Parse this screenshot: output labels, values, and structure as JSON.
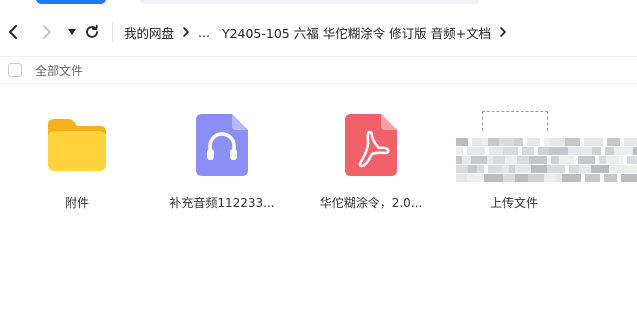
{
  "nav": {
    "back_icon": "chevron-left-icon",
    "forward_icon": "chevron-right-icon",
    "history_icon": "caret-down-icon",
    "refresh_icon": "refresh-icon"
  },
  "breadcrumb": {
    "root": "我的网盘",
    "ellipsis": "...",
    "current": "Y2405-105 六福 华佗糊涂令 修订版 音频+文档"
  },
  "toolbar": {
    "select_all_label": "全部文件"
  },
  "files": [
    {
      "name": "附件",
      "type": "folder",
      "icon": "folder-icon",
      "color": "#fbc02d"
    },
    {
      "name": "补充音频112233...",
      "type": "audio",
      "icon": "headphones-icon",
      "color": "#8b8ff5"
    },
    {
      "name": "华佗糊涂令，2.0...",
      "type": "pdf",
      "icon": "pdf-icon",
      "color": "#f2606a"
    },
    {
      "name": "上传文件",
      "type": "upload",
      "icon": "upload-placeholder-icon"
    }
  ],
  "colors": {
    "accent": "#1e7bf5"
  }
}
